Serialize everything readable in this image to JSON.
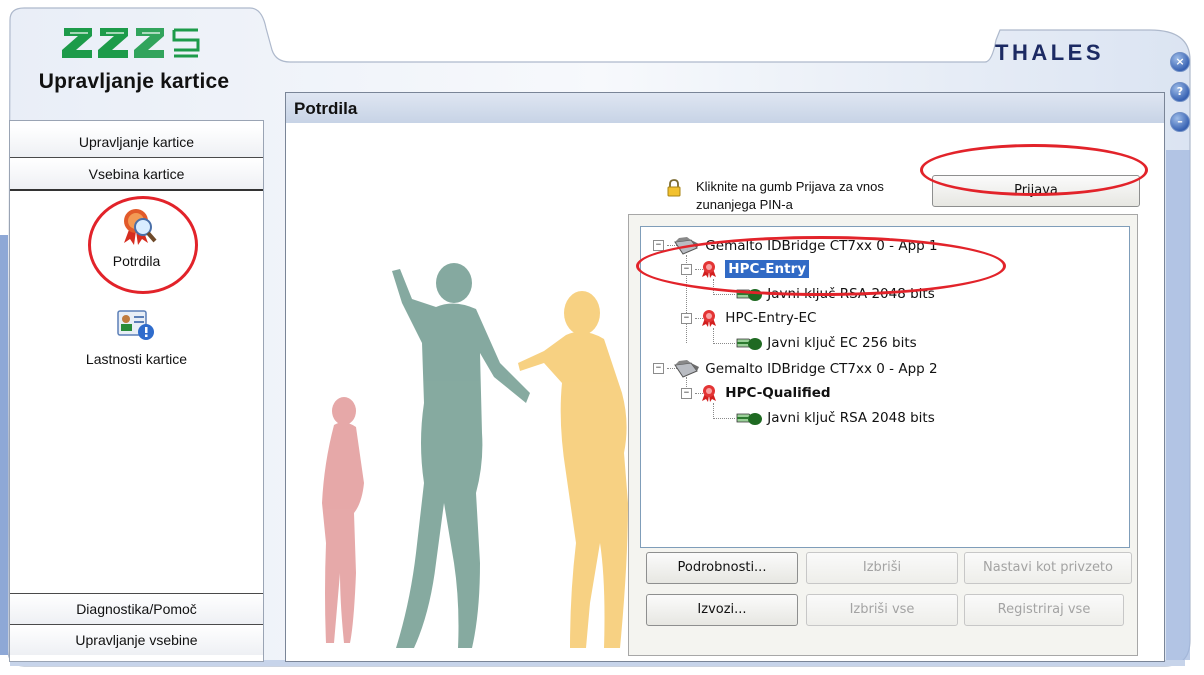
{
  "app": {
    "title": "Upravljanje kartice",
    "brand": "THALES"
  },
  "window_buttons": {
    "close": "×",
    "help": "?",
    "minimize": "–"
  },
  "sidebar": {
    "tabs_top": [
      "Upravljanje kartice",
      "Vsebina kartice"
    ],
    "items": [
      {
        "label": "Potrdila",
        "icon": "certificate-search-icon"
      },
      {
        "label": "Lastnosti kartice",
        "icon": "card-properties-icon"
      }
    ],
    "tabs_bottom": [
      "Diagnostika/Pomoč",
      "Upravljanje vsebine"
    ]
  },
  "main": {
    "title": "Potrdila",
    "hint": "Kliknite na gumb Prijava za vnos zunanjega PIN-a",
    "login_button": "Prijava",
    "tree": [
      {
        "label": "Gemalto IDBridge CT7xx 0 - App 1",
        "icon": "card-reader-icon",
        "level": 0
      },
      {
        "label": "HPC-Entry",
        "icon": "certificate-icon",
        "level": 1,
        "selected": true
      },
      {
        "label": "Javni ključ RSA 2048 bits",
        "icon": "key-icon",
        "level": 2
      },
      {
        "label": "HPC-Entry-EC",
        "icon": "certificate-icon",
        "level": 1
      },
      {
        "label": "Javni ključ EC 256 bits",
        "icon": "key-icon",
        "level": 2
      },
      {
        "label": "Gemalto IDBridge CT7xx 0 - App 2",
        "icon": "card-reader-icon",
        "level": 0
      },
      {
        "label": "HPC-Qualified",
        "icon": "certificate-icon",
        "level": 1,
        "bold": true
      },
      {
        "label": "Javni ključ RSA 2048 bits",
        "icon": "key-icon",
        "level": 2
      }
    ],
    "buttons": {
      "details": "Podrobnosti...",
      "delete": "Izbriši",
      "set_default": "Nastavi kot privzeto",
      "export": "Izvozi...",
      "delete_all": "Izbriši vse",
      "register_all": "Registriraj vse"
    }
  },
  "colors": {
    "accent_blue": "#3a64b4",
    "frame_blue": "#c9d6ea",
    "annotation_red": "#e2232a",
    "selection_blue": "#316ac5",
    "thales_navy": "#1c2a63"
  }
}
